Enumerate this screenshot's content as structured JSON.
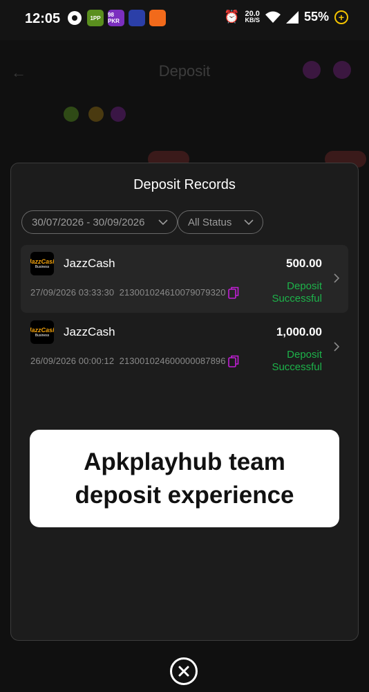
{
  "status_bar": {
    "time": "12:05",
    "apps": [
      "1PP",
      "98 PKR",
      "Game",
      "App"
    ],
    "net_speed_value": "20.0",
    "net_speed_unit": "KB/S",
    "battery": "55%"
  },
  "background_page": {
    "title": "Deposit"
  },
  "modal": {
    "title": "Deposit Records",
    "date_filter": "30/07/2026 - 30/09/2026",
    "status_filter": "All Status",
    "records": [
      {
        "method": "JazzCash",
        "amount": "500.00",
        "datetime": "27/09/2026 03:33:30",
        "order_id": "21300102461007907932​0",
        "status_line1": "Deposit",
        "status_line2": "Successful"
      },
      {
        "method": "JazzCash",
        "amount": "1,000.00",
        "datetime": "26/09/2026 00:00:12",
        "order_id": "213001024600000087896",
        "status_line1": "Deposit",
        "status_line2": "Successful"
      }
    ],
    "logo_text_top": "JazzCash",
    "logo_text_bottom": "Business"
  },
  "caption": {
    "line1": "Apkplayhub team",
    "line2": "deposit experience"
  },
  "colors": {
    "success": "#1db34a",
    "accent": "#c21fd6"
  }
}
